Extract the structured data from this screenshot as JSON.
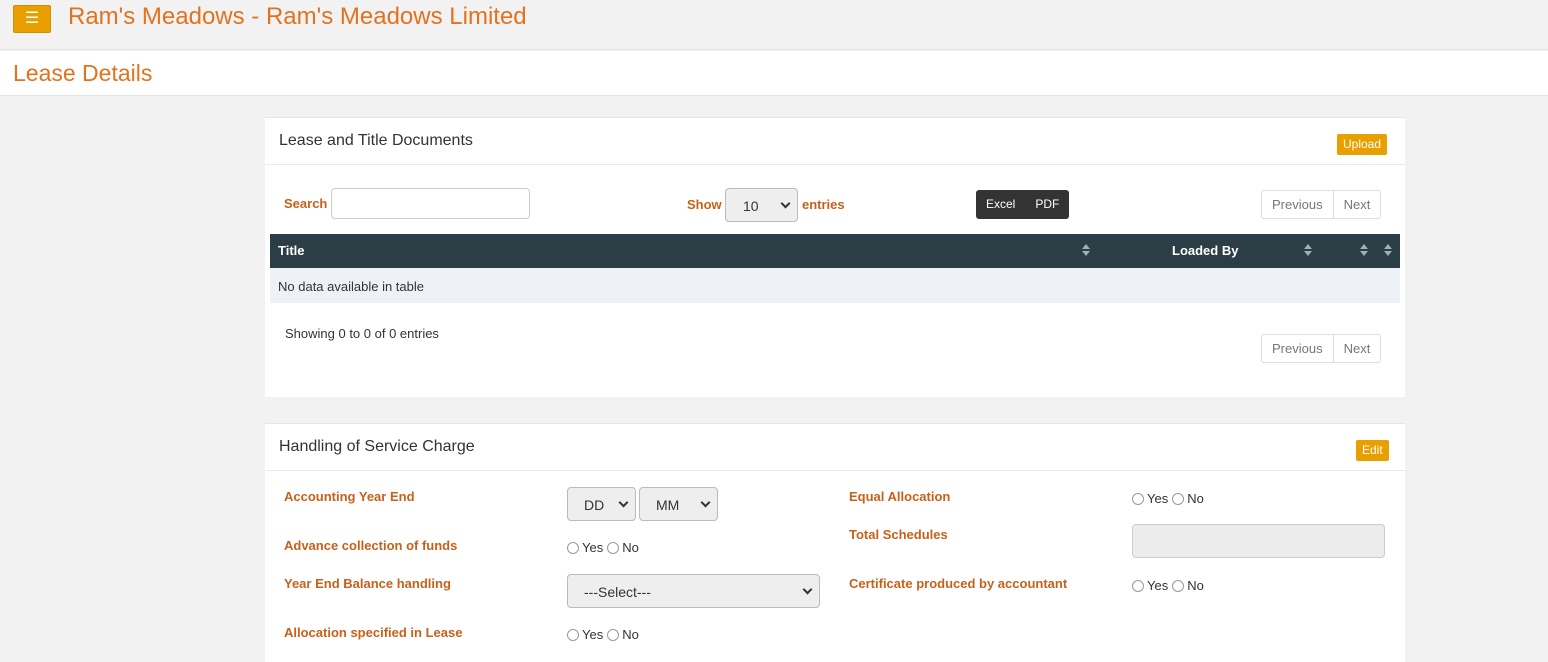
{
  "app": {
    "title": "Ram's Meadows - Ram's Meadows Limited",
    "menu_icon": "hamburger-icon"
  },
  "page": {
    "title": "Lease Details"
  },
  "documents": {
    "title": "Lease and Title Documents",
    "upload_label": "Upload",
    "search_label": "Search",
    "search_value": "",
    "show_label": "Show",
    "entries_value": "10",
    "entries_label": "entries",
    "export_buttons": [
      "Excel",
      "PDF"
    ],
    "previous_label": "Previous",
    "next_label": "Next",
    "columns": [
      "Title",
      "Loaded By"
    ],
    "empty_message": "No data available in table",
    "info": "Showing 0 to 0 of 0 entries"
  },
  "service_charge": {
    "title": "Handling of Service Charge",
    "edit_label": "Edit",
    "accounting_year_end": {
      "label": "Accounting Year End",
      "day": "DD",
      "month": "MM"
    },
    "advance_collection": {
      "label": "Advance collection of funds",
      "yes": "Yes",
      "no": "No"
    },
    "year_end_balance": {
      "label": "Year End Balance handling",
      "value": "---Select---"
    },
    "allocation_specified": {
      "label": "Allocation specified in Lease",
      "yes": "Yes",
      "no": "No"
    },
    "equal_allocation": {
      "label": "Equal Allocation",
      "yes": "Yes",
      "no": "No"
    },
    "total_schedules": {
      "label": "Total Schedules",
      "value": ""
    },
    "certificate": {
      "label": "Certificate produced by accountant",
      "yes": "Yes",
      "no": "No"
    }
  },
  "colors": {
    "accent": "#e2731e",
    "button": "#e8a000",
    "label": "#c7611a",
    "table_header": "#2c3e45"
  }
}
